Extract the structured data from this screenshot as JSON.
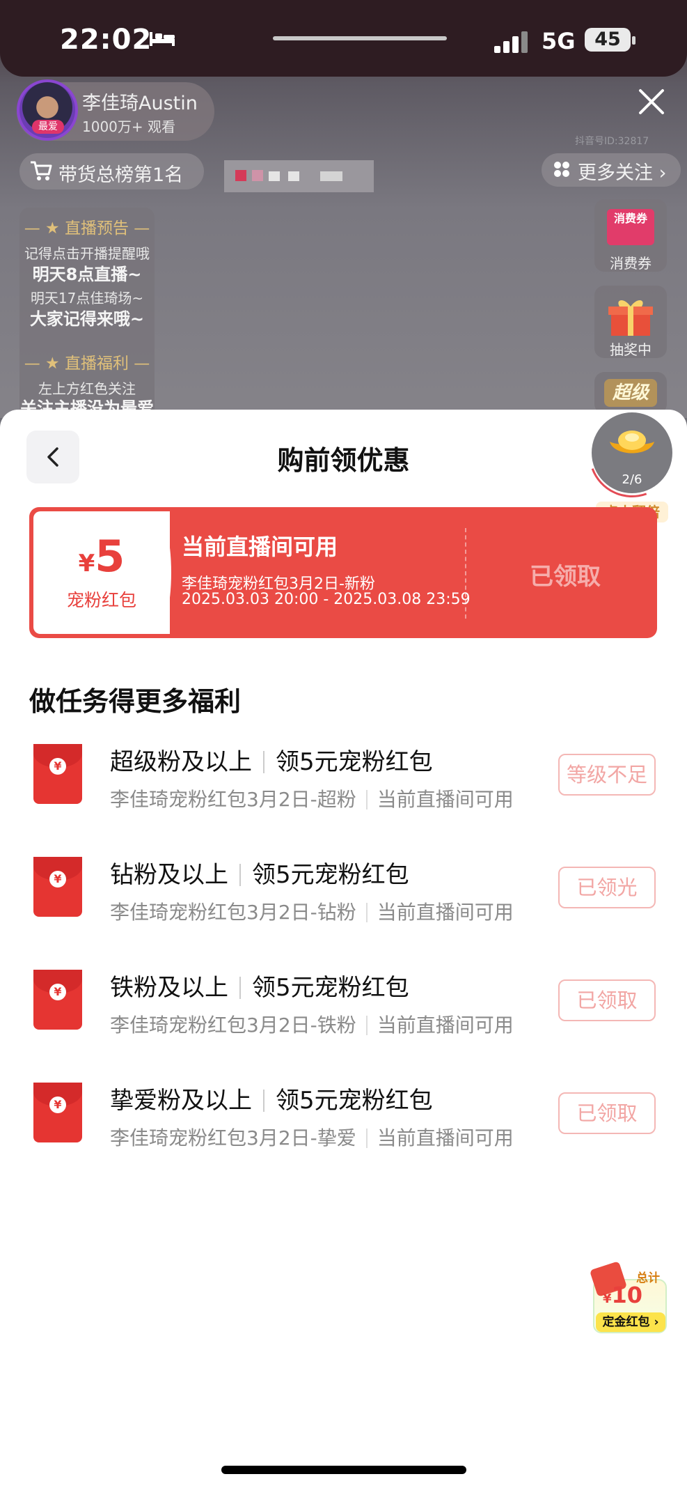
{
  "status_bar": {
    "time": "22:02",
    "network": "5G",
    "battery": "45"
  },
  "live_room": {
    "host_name": "李佳琦Austin",
    "host_views": "1000万+ 观看",
    "host_badge": "最爱",
    "rank_label": "带货总榜第1名",
    "anchor_id": "抖音号ID:32817",
    "more_follow": "更多关注",
    "notice": {
      "preview_heading": "直播预告",
      "preview_line1": "记得点击开播提醒哦",
      "preview_line2": "明天8点直播~",
      "preview_line3": "明天17点佳琦场~",
      "preview_line4": "大家记得来哦~",
      "welfare_heading": "直播福利",
      "welfare_line1": "左上方红色关注",
      "welfare_line2": "关注主播没为最爱"
    },
    "side": {
      "coupon_img_text": "消费券",
      "coupon_label": "消费券",
      "lottery_label": "抽奖中",
      "super_img_text": "超级"
    }
  },
  "sheet": {
    "title": "购前领优惠",
    "ingot_progress": "2/6",
    "double_tag": "点击翻倍",
    "coupon": {
      "currency": "¥",
      "amount": "5",
      "type": "宠粉红包",
      "title": "当前直播间可用",
      "desc": "李佳琦宠粉红包3月2日-新粉",
      "time": "2025.03.03 20:00 - 2025.03.08 23:59",
      "status": "已领取"
    },
    "section_title": "做任务得更多福利",
    "tasks": [
      {
        "level": "超级粉及以上",
        "reward": "领5元宠粉红包",
        "name": "李佳琦宠粉红包3月2日-超粉",
        "scope": "当前直播间可用",
        "button": "等级不足"
      },
      {
        "level": "钻粉及以上",
        "reward": "领5元宠粉红包",
        "name": "李佳琦宠粉红包3月2日-钻粉",
        "scope": "当前直播间可用",
        "button": "已领光"
      },
      {
        "level": "铁粉及以上",
        "reward": "领5元宠粉红包",
        "name": "李佳琦宠粉红包3月2日-铁粉",
        "scope": "当前直播间可用",
        "button": "已领取"
      },
      {
        "level": "挚爱粉及以上",
        "reward": "领5元宠粉红包",
        "name": "李佳琦宠粉红包3月2日-挚爱",
        "scope": "当前直播间可用",
        "button": "已领取"
      }
    ],
    "deposit": {
      "total_label": "总计",
      "currency": "¥",
      "amount": "10",
      "label": "定金红包 ›"
    }
  },
  "colors": {
    "accent_red": "#ea4b45",
    "disabled_text": "#f2a6a4"
  }
}
